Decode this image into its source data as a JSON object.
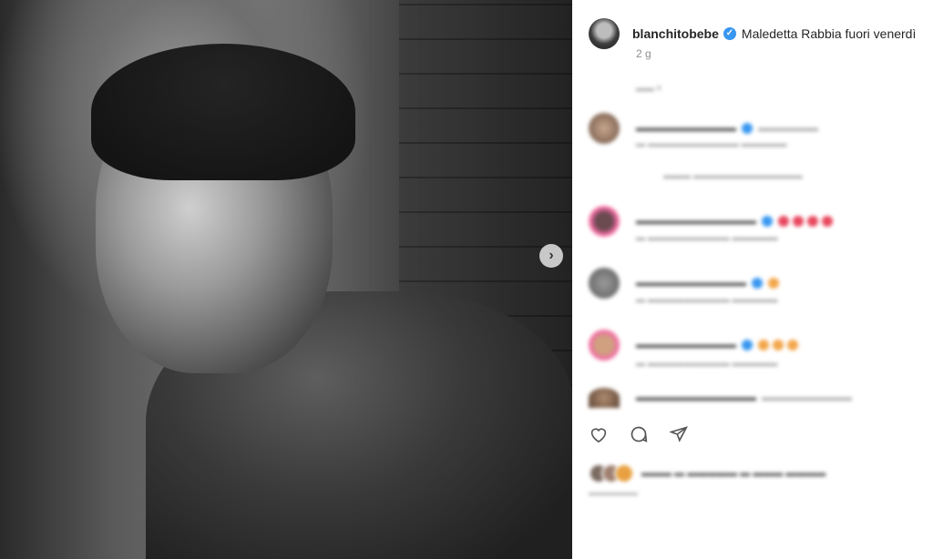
{
  "post": {
    "username": "blanchitobebe",
    "caption": "Maledetta Rabbia fuori venerdì",
    "time_ago": "2 g"
  },
  "colors": {
    "verified": "#3897f0",
    "text_primary": "#262626",
    "text_secondary": "#8e8e8e"
  },
  "icons": [
    "verified-icon",
    "heart-icon",
    "comment-icon",
    "share-icon",
    "next-arrow-icon"
  ]
}
